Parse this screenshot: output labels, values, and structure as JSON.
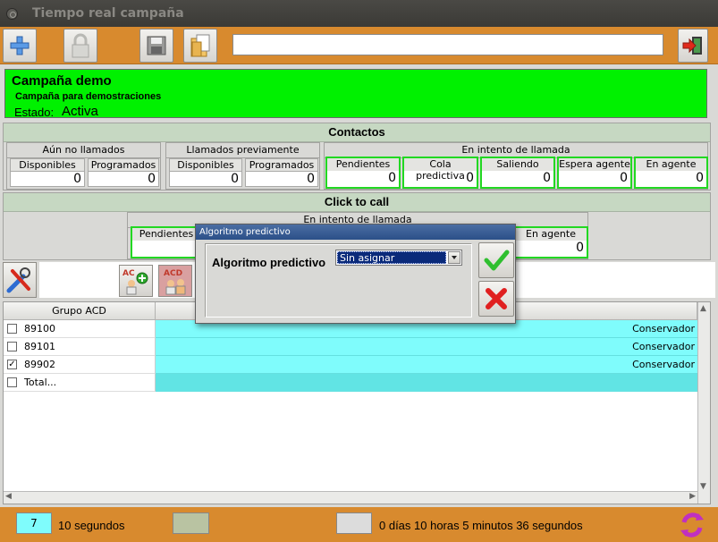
{
  "window": {
    "title": "Tiempo real campaña"
  },
  "toolbar": {
    "search_value": ""
  },
  "campaign": {
    "name": "Campaña demo",
    "description": "Campaña para demostraciones",
    "state_label": "Estado:",
    "state": "Activa"
  },
  "contacts": {
    "title": "Contactos",
    "not_called": {
      "title": "Aún no llamados",
      "available_label": "Disponibles",
      "available": "0",
      "scheduled_label": "Programados",
      "scheduled": "0"
    },
    "called": {
      "title": "Llamados previamente",
      "available_label": "Disponibles",
      "available": "0",
      "scheduled_label": "Programados",
      "scheduled": "0"
    },
    "in_progress": {
      "title": "En intento de llamada",
      "pending_label": "Pendientes",
      "pending": "0",
      "queue_label": "Cola predictiva",
      "queue": "0",
      "dialing_label": "Saliendo",
      "dialing": "0",
      "wait_label": "Espera agente",
      "wait": "0",
      "agent_label": "En agente",
      "agent": "0"
    }
  },
  "click_to_call": {
    "title": "Click to call",
    "group_title": "En intento de llamada",
    "pending_label": "Pendientes",
    "agent_label": "En agente",
    "agent": "0"
  },
  "grid": {
    "col0_header": "Grupo ACD",
    "rows": [
      {
        "name": "89100",
        "checked": false,
        "check": "",
        "algorithm": "Conservador"
      },
      {
        "name": "89101",
        "checked": false,
        "check": "",
        "algorithm": "Conservador"
      },
      {
        "name": "89902",
        "checked": true,
        "check": "✓",
        "algorithm": "Conservador"
      },
      {
        "name": "Total...",
        "checked": false,
        "check": "",
        "algorithm": ""
      }
    ]
  },
  "dialog": {
    "title": "Algoritmo predictivo",
    "label": "Algoritmo predictivo",
    "selected": "Sin asignar"
  },
  "footer": {
    "refresh_value": "7",
    "refresh_unit": "10 segundos",
    "elapsed": "0 días 10 horas 5 minutos 36 segundos"
  },
  "colors": {
    "accent": "#d88a2e",
    "campaign_bg": "#00f100",
    "row_bg": "#7ffcfc"
  }
}
